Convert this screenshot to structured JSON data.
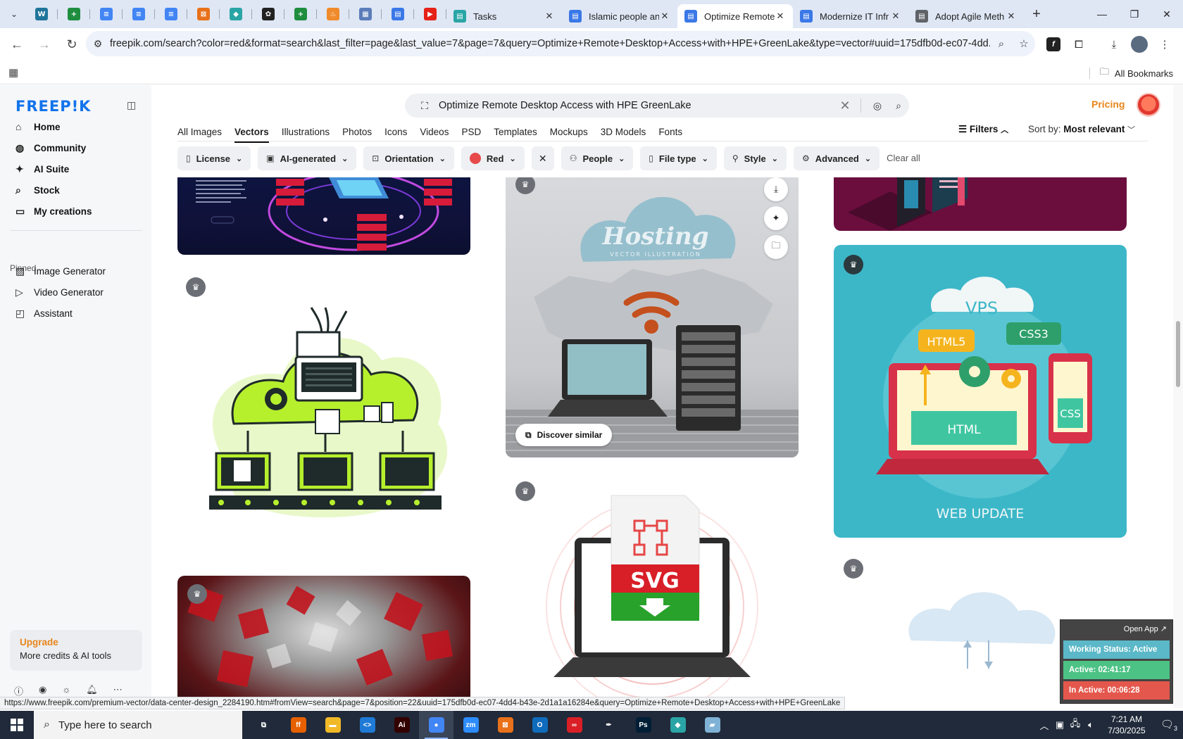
{
  "browser": {
    "tabs_menu_icon": "chevron-down-icon",
    "pinned_tabs": [
      {
        "name": "wordpress",
        "color": "#21759b",
        "glyph": "W"
      },
      {
        "name": "sheets",
        "color": "#1e8e3e",
        "glyph": "+"
      },
      {
        "name": "docs",
        "color": "#4285f4",
        "glyph": "≡"
      },
      {
        "name": "docs",
        "color": "#4285f4",
        "glyph": "≡"
      },
      {
        "name": "docs",
        "color": "#4285f4",
        "glyph": "≡"
      },
      {
        "name": "extension",
        "color": "#e8711a",
        "glyph": "⊠"
      },
      {
        "name": "app",
        "color": "#2aa5a5",
        "glyph": "◆"
      },
      {
        "name": "openai",
        "color": "#222222",
        "glyph": "✿"
      },
      {
        "name": "sheets",
        "color": "#1e8e3e",
        "glyph": "+"
      },
      {
        "name": "app",
        "color": "#f08a2a",
        "glyph": "♨"
      },
      {
        "name": "app",
        "color": "#5b7db9",
        "glyph": "▦"
      },
      {
        "name": "forms",
        "color": "#3b78e7",
        "glyph": "▤"
      },
      {
        "name": "youtube",
        "color": "#e62117",
        "glyph": "▶"
      }
    ],
    "tabs": [
      {
        "title": "Tasks",
        "icon_color": "#2aa5a5",
        "active": false
      },
      {
        "title": "Islamic people an",
        "icon_color": "#3b78e7",
        "active": false
      },
      {
        "title": "Optimize Remote",
        "icon_color": "#3b78e7",
        "active": true
      },
      {
        "title": "Modernize IT Infr",
        "icon_color": "#3b78e7",
        "active": false
      },
      {
        "title": "Adopt Agile Meth",
        "icon_color": "#5f6368",
        "active": false
      }
    ],
    "url": "freepik.com/search?color=red&format=search&last_filter=page&last_value=7&page=7&query=Optimize+Remote+Desktop+Access+with+HPE+GreenLake&type=vector#uuid=175dfb0d-ec07-4dd...",
    "all_bookmarks": "All Bookmarks",
    "status_url": "https://www.freepik.com/premium-vector/data-center-design_2284190.htm#fromView=search&page=7&position=22&uuid=175dfb0d-ec07-4dd4-b43e-2d1a1a16284e&query=Optimize+Remote+Desktop+Access+with+HPE+GreenLake"
  },
  "freepik": {
    "logo": "FREEP!K",
    "nav": [
      {
        "label": "Home",
        "icon": "home-icon"
      },
      {
        "label": "Community",
        "icon": "globe-icon"
      },
      {
        "label": "AI Suite",
        "icon": "sparkle-icon"
      },
      {
        "label": "Stock",
        "icon": "search-icon"
      },
      {
        "label": "My creations",
        "icon": "folder-icon"
      }
    ],
    "pinned_label": "Pinned",
    "pinned": [
      {
        "label": "Image Generator",
        "icon": "image-icon"
      },
      {
        "label": "Video Generator",
        "icon": "video-icon"
      },
      {
        "label": "Assistant",
        "icon": "chat-icon"
      }
    ],
    "upgrade_title": "Upgrade",
    "upgrade_sub": "More credits & AI tools",
    "search_query": "Optimize Remote Desktop Access with HPE GreenLake",
    "pricing": "Pricing",
    "type_tabs": [
      "All Images",
      "Vectors",
      "Illustrations",
      "Photos",
      "Icons",
      "Videos",
      "PSD",
      "Templates",
      "Mockups",
      "3D Models",
      "Fonts"
    ],
    "active_type": "Vectors",
    "filters_label": "Filters",
    "sort_label": "Sort by:",
    "sort_value": "Most relevant",
    "chips": [
      {
        "label": "License",
        "icon": "license-icon"
      },
      {
        "label": "AI-generated",
        "icon": "ai-icon"
      },
      {
        "label": "Orientation",
        "icon": "orientation-icon"
      },
      {
        "label": "Red",
        "icon": "color-dot"
      },
      {
        "label": "People",
        "icon": "people-icon"
      },
      {
        "label": "File type",
        "icon": "file-icon"
      },
      {
        "label": "Style",
        "icon": "brush-icon"
      },
      {
        "label": "Advanced",
        "icon": "gear-icon"
      }
    ],
    "clear_all": "Clear all",
    "accent_color": "#e8851a",
    "filter_color": "#e74a4a",
    "discover_similar": "Discover similar",
    "card_texts": {
      "hosting_title": "Hosting",
      "hosting_sub": "VECTOR ILLUSTRATION",
      "vps": "VPS",
      "html5": "HTML5",
      "css3": "CSS3",
      "html": "HTML",
      "css": "CSS",
      "web_update": "WEB UPDATE",
      "svg": "SVG"
    }
  },
  "tracker": {
    "open_app": "Open App ↗",
    "working": "Working Status: Active",
    "active": "Active: 02:41:17",
    "inactive": "In Active: 00:06:28",
    "colors": {
      "working": "#5bb8c8",
      "active": "#4cc285",
      "inactive": "#e4574c"
    }
  },
  "taskbar": {
    "search_placeholder": "Type here to search",
    "time": "7:21 AM",
    "date": "7/30/2025",
    "notifications": "3",
    "apps": [
      {
        "name": "task-view",
        "color": "#202a3a",
        "glyph": "⧉"
      },
      {
        "name": "firefox",
        "color": "#e66000",
        "glyph": "ff"
      },
      {
        "name": "file-explorer",
        "color": "#f2b927",
        "glyph": "▬"
      },
      {
        "name": "vscode",
        "color": "#1f7ad6",
        "glyph": "<>"
      },
      {
        "name": "illustrator",
        "color": "#330000",
        "glyph": "Ai"
      },
      {
        "name": "chrome",
        "color": "#4285f4",
        "glyph": "●",
        "active": true
      },
      {
        "name": "zoom",
        "color": "#2d8cff",
        "glyph": "zm"
      },
      {
        "name": "app",
        "color": "#e8711a",
        "glyph": "⊠"
      },
      {
        "name": "outlook",
        "color": "#0f6cbd",
        "glyph": "O"
      },
      {
        "name": "creative-cloud",
        "color": "#da1f26",
        "glyph": "∞"
      },
      {
        "name": "pen-tool",
        "color": "#202a3a",
        "glyph": "✒"
      },
      {
        "name": "photoshop",
        "color": "#001e36",
        "glyph": "Ps"
      },
      {
        "name": "app",
        "color": "#2aa5a5",
        "glyph": "◆"
      },
      {
        "name": "app",
        "color": "#7fb2d6",
        "glyph": "▰"
      }
    ]
  }
}
